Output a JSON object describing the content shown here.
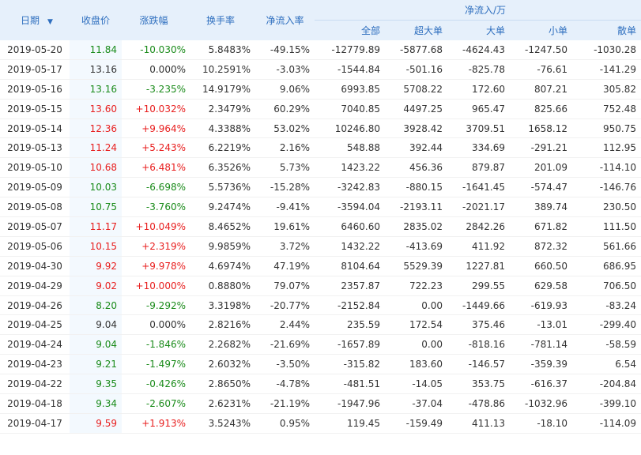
{
  "headers": {
    "date": "日期",
    "close": "收盘价",
    "change": "涨跌幅",
    "turnover": "换手率",
    "net_rate": "净流入率",
    "netflow_group": "净流入/万",
    "all": "全部",
    "xlarge": "超大单",
    "large": "大单",
    "medium": "小单",
    "small": "散单"
  },
  "icons": {
    "sort": "sort-down-icon"
  },
  "colors": {
    "up": "#e81e1e",
    "down": "#1a8b1a",
    "header_bg": "#e6f0fb",
    "header_text": "#2f6fbf"
  },
  "rows": [
    {
      "date": "2019-05-20",
      "close": "11.84",
      "change": "-10.030%",
      "turnover": "5.8483%",
      "net_rate": "-49.15%",
      "all": "-12779.89",
      "xlarge": "-5877.68",
      "large": "-4624.43",
      "medium": "-1247.50",
      "small": "-1030.28",
      "trend": "down"
    },
    {
      "date": "2019-05-17",
      "close": "13.16",
      "change": "0.000%",
      "turnover": "10.2591%",
      "net_rate": "-3.03%",
      "all": "-1544.84",
      "xlarge": "-501.16",
      "large": "-825.78",
      "medium": "-76.61",
      "small": "-141.29",
      "trend": "flat"
    },
    {
      "date": "2019-05-16",
      "close": "13.16",
      "change": "-3.235%",
      "turnover": "14.9179%",
      "net_rate": "9.06%",
      "all": "6993.85",
      "xlarge": "5708.22",
      "large": "172.60",
      "medium": "807.21",
      "small": "305.82",
      "trend": "down"
    },
    {
      "date": "2019-05-15",
      "close": "13.60",
      "change": "+10.032%",
      "turnover": "2.3479%",
      "net_rate": "60.29%",
      "all": "7040.85",
      "xlarge": "4497.25",
      "large": "965.47",
      "medium": "825.66",
      "small": "752.48",
      "trend": "up"
    },
    {
      "date": "2019-05-14",
      "close": "12.36",
      "change": "+9.964%",
      "turnover": "4.3388%",
      "net_rate": "53.02%",
      "all": "10246.80",
      "xlarge": "3928.42",
      "large": "3709.51",
      "medium": "1658.12",
      "small": "950.75",
      "trend": "up"
    },
    {
      "date": "2019-05-13",
      "close": "11.24",
      "change": "+5.243%",
      "turnover": "6.2219%",
      "net_rate": "2.16%",
      "all": "548.88",
      "xlarge": "392.44",
      "large": "334.69",
      "medium": "-291.21",
      "small": "112.95",
      "trend": "up"
    },
    {
      "date": "2019-05-10",
      "close": "10.68",
      "change": "+6.481%",
      "turnover": "6.3526%",
      "net_rate": "5.73%",
      "all": "1423.22",
      "xlarge": "456.36",
      "large": "879.87",
      "medium": "201.09",
      "small": "-114.10",
      "trend": "up"
    },
    {
      "date": "2019-05-09",
      "close": "10.03",
      "change": "-6.698%",
      "turnover": "5.5736%",
      "net_rate": "-15.28%",
      "all": "-3242.83",
      "xlarge": "-880.15",
      "large": "-1641.45",
      "medium": "-574.47",
      "small": "-146.76",
      "trend": "down"
    },
    {
      "date": "2019-05-08",
      "close": "10.75",
      "change": "-3.760%",
      "turnover": "9.2474%",
      "net_rate": "-9.41%",
      "all": "-3594.04",
      "xlarge": "-2193.11",
      "large": "-2021.17",
      "medium": "389.74",
      "small": "230.50",
      "trend": "down"
    },
    {
      "date": "2019-05-07",
      "close": "11.17",
      "change": "+10.049%",
      "turnover": "8.4652%",
      "net_rate": "19.61%",
      "all": "6460.60",
      "xlarge": "2835.02",
      "large": "2842.26",
      "medium": "671.82",
      "small": "111.50",
      "trend": "up"
    },
    {
      "date": "2019-05-06",
      "close": "10.15",
      "change": "+2.319%",
      "turnover": "9.9859%",
      "net_rate": "3.72%",
      "all": "1432.22",
      "xlarge": "-413.69",
      "large": "411.92",
      "medium": "872.32",
      "small": "561.66",
      "trend": "up"
    },
    {
      "date": "2019-04-30",
      "close": "9.92",
      "change": "+9.978%",
      "turnover": "4.6974%",
      "net_rate": "47.19%",
      "all": "8104.64",
      "xlarge": "5529.39",
      "large": "1227.81",
      "medium": "660.50",
      "small": "686.95",
      "trend": "up"
    },
    {
      "date": "2019-04-29",
      "close": "9.02",
      "change": "+10.000%",
      "turnover": "0.8880%",
      "net_rate": "79.07%",
      "all": "2357.87",
      "xlarge": "722.23",
      "large": "299.55",
      "medium": "629.58",
      "small": "706.50",
      "trend": "up"
    },
    {
      "date": "2019-04-26",
      "close": "8.20",
      "change": "-9.292%",
      "turnover": "3.3198%",
      "net_rate": "-20.77%",
      "all": "-2152.84",
      "xlarge": "0.00",
      "large": "-1449.66",
      "medium": "-619.93",
      "small": "-83.24",
      "trend": "down"
    },
    {
      "date": "2019-04-25",
      "close": "9.04",
      "change": "0.000%",
      "turnover": "2.8216%",
      "net_rate": "2.44%",
      "all": "235.59",
      "xlarge": "172.54",
      "large": "375.46",
      "medium": "-13.01",
      "small": "-299.40",
      "trend": "flat"
    },
    {
      "date": "2019-04-24",
      "close": "9.04",
      "change": "-1.846%",
      "turnover": "2.2682%",
      "net_rate": "-21.69%",
      "all": "-1657.89",
      "xlarge": "0.00",
      "large": "-818.16",
      "medium": "-781.14",
      "small": "-58.59",
      "trend": "down"
    },
    {
      "date": "2019-04-23",
      "close": "9.21",
      "change": "-1.497%",
      "turnover": "2.6032%",
      "net_rate": "-3.50%",
      "all": "-315.82",
      "xlarge": "183.60",
      "large": "-146.57",
      "medium": "-359.39",
      "small": "6.54",
      "trend": "down"
    },
    {
      "date": "2019-04-22",
      "close": "9.35",
      "change": "-0.426%",
      "turnover": "2.8650%",
      "net_rate": "-4.78%",
      "all": "-481.51",
      "xlarge": "-14.05",
      "large": "353.75",
      "medium": "-616.37",
      "small": "-204.84",
      "trend": "down"
    },
    {
      "date": "2019-04-18",
      "close": "9.34",
      "change": "-2.607%",
      "turnover": "2.6231%",
      "net_rate": "-21.19%",
      "all": "-1947.96",
      "xlarge": "-37.04",
      "large": "-478.86",
      "medium": "-1032.96",
      "small": "-399.10",
      "trend": "down"
    },
    {
      "date": "2019-04-17",
      "close": "9.59",
      "change": "+1.913%",
      "turnover": "3.5243%",
      "net_rate": "0.95%",
      "all": "119.45",
      "xlarge": "-159.49",
      "large": "411.13",
      "medium": "-18.10",
      "small": "-114.09",
      "trend": "up"
    }
  ]
}
